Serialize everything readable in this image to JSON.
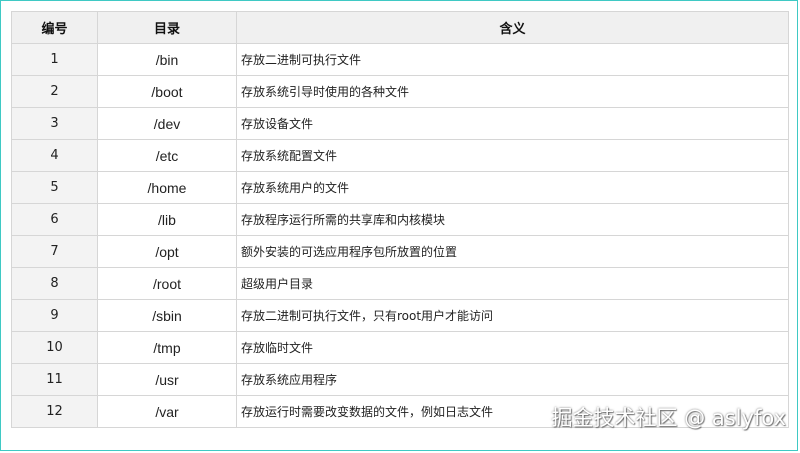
{
  "table": {
    "headers": [
      "编号",
      "目录",
      "含义"
    ],
    "rows": [
      {
        "num": "1",
        "dir": "/bin",
        "desc": "存放二进制可执行文件"
      },
      {
        "num": "2",
        "dir": "/boot",
        "desc": "存放系统引导时使用的各种文件"
      },
      {
        "num": "3",
        "dir": "/dev",
        "desc": "存放设备文件"
      },
      {
        "num": "4",
        "dir": "/etc",
        "desc": "存放系统配置文件"
      },
      {
        "num": "5",
        "dir": "/home",
        "desc": "存放系统用户的文件"
      },
      {
        "num": "6",
        "dir": "/lib",
        "desc": "存放程序运行所需的共享库和内核模块"
      },
      {
        "num": "7",
        "dir": "/opt",
        "desc": "额外安装的可选应用程序包所放置的位置"
      },
      {
        "num": "8",
        "dir": "/root",
        "desc": "超级用户目录"
      },
      {
        "num": "9",
        "dir": "/sbin",
        "desc": "存放二进制可执行文件，只有root用户才能访问"
      },
      {
        "num": "10",
        "dir": "/tmp",
        "desc": "存放临时文件"
      },
      {
        "num": "11",
        "dir": "/usr",
        "desc": "存放系统应用程序"
      },
      {
        "num": "12",
        "dir": "/var",
        "desc": "存放运行时需要改变数据的文件，例如日志文件"
      }
    ]
  },
  "watermark": "掘金技术社区 @ aslyfox",
  "colors": {
    "frame_border": "#3fc9c4",
    "header_bg": "#f0f0f0",
    "num_col_bg": "#f3f3f3",
    "grid": "#d6d6d6"
  }
}
